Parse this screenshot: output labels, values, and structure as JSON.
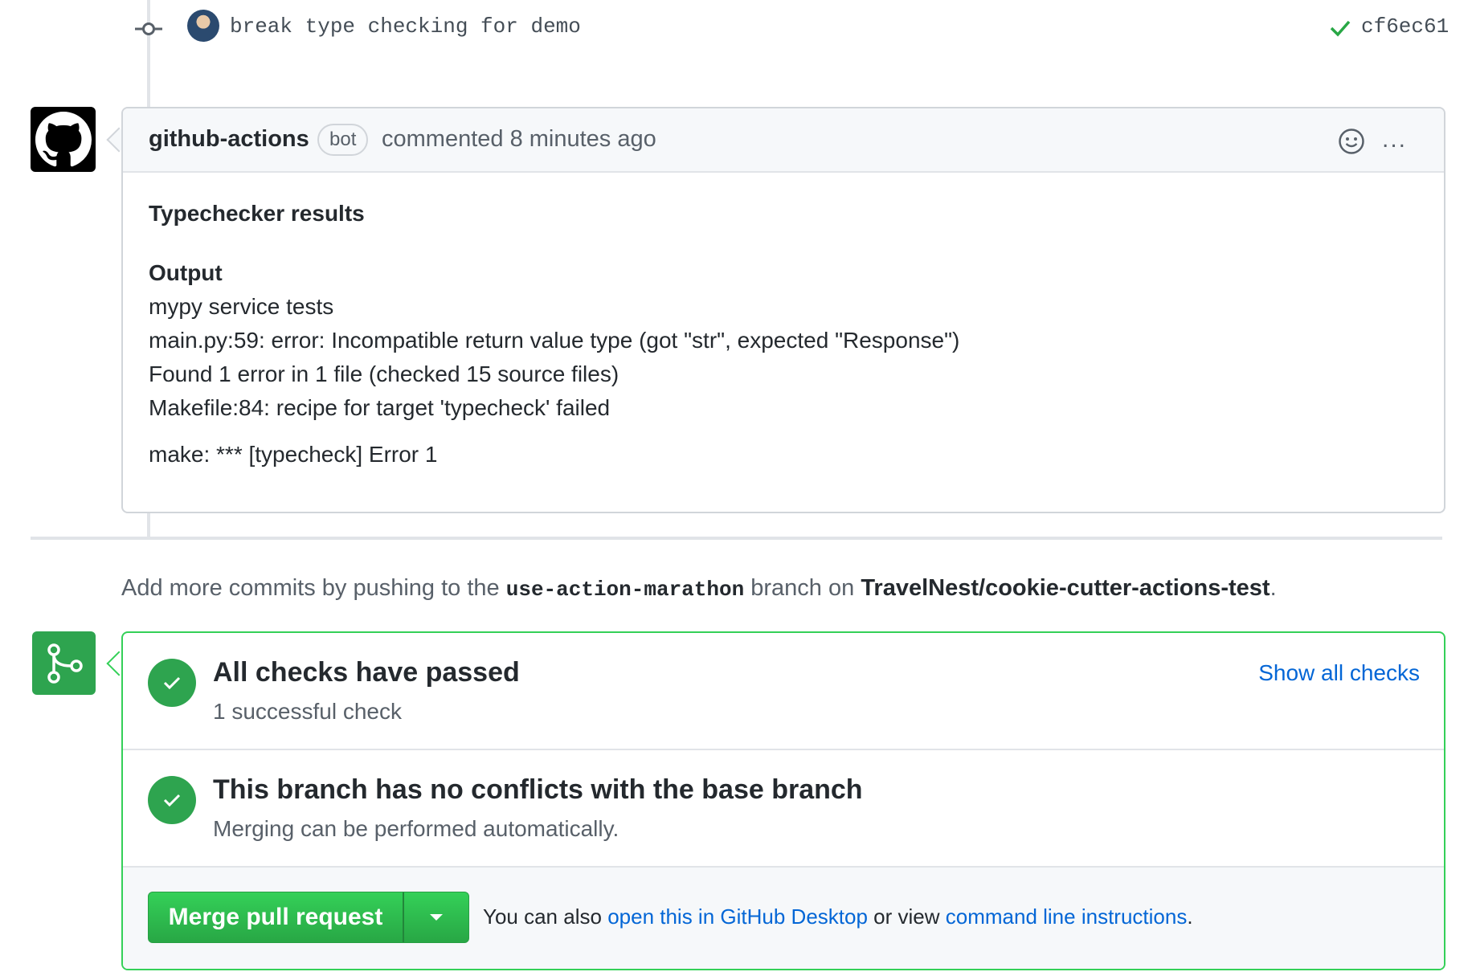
{
  "commit": {
    "message": "break type checking for demo",
    "sha": "cf6ec61",
    "status_icon": "check-icon"
  },
  "comment": {
    "author": "github-actions",
    "badge": "bot",
    "meta": "commented 8 minutes ago",
    "title": "Typechecker results",
    "output_label": "Output",
    "lines": [
      "mypy service tests",
      "main.py:59: error: Incompatible return value type (got \"str\", expected \"Response\")",
      "Found 1 error in 1 file (checked 15 source files)",
      "Makefile:84: recipe for target 'typecheck' failed"
    ],
    "last_line": "make: *** [typecheck] Error 1",
    "more_label": "..."
  },
  "push_note": {
    "prefix": "Add more commits by pushing to the",
    "branch": "use-action-marathon",
    "middle": "branch on",
    "repo": "TravelNest/cookie-cutter-actions-test",
    "suffix": "."
  },
  "merge": {
    "checks_title": "All checks have passed",
    "checks_sub": "1 successful check",
    "show_all": "Show all checks",
    "conflicts_title": "This branch has no conflicts with the base branch",
    "conflicts_sub": "Merging can be performed automatically.",
    "button_label": "Merge pull request",
    "hint_prefix": "You can also",
    "hint_link1": "open this in GitHub Desktop",
    "hint_middle": "or view",
    "hint_link2": "command line instructions",
    "hint_suffix": "."
  },
  "colors": {
    "success": "#2ea44f",
    "link": "#0366d6",
    "border": "#d1d5da"
  }
}
